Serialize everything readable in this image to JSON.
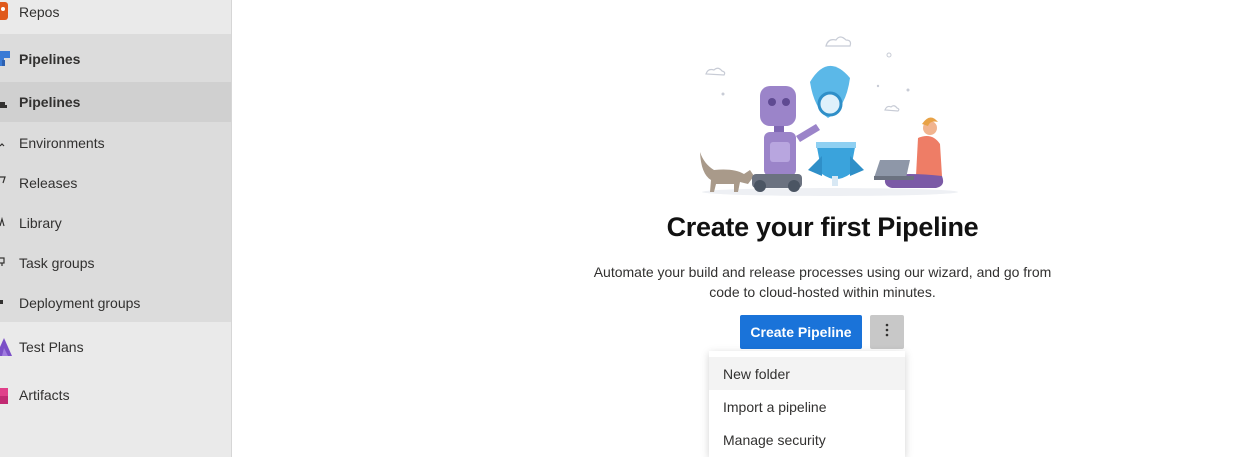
{
  "sidebar": {
    "items": [
      {
        "label": "Repos",
        "icon": "repos-icon",
        "color": "#e05a1c"
      },
      {
        "label": "Pipelines",
        "icon": "pipelines-icon",
        "color": "#3a7bd5"
      },
      {
        "label": "Pipelines",
        "icon": "pipelines-sub-icon"
      },
      {
        "label": "Environments",
        "icon": "environments-icon"
      },
      {
        "label": "Releases",
        "icon": "releases-icon"
      },
      {
        "label": "Library",
        "icon": "library-icon"
      },
      {
        "label": "Task groups",
        "icon": "task-groups-icon"
      },
      {
        "label": "Deployment groups",
        "icon": "deployment-groups-icon"
      },
      {
        "label": "Test Plans",
        "icon": "test-plans-icon",
        "color": "#7b4fc7"
      },
      {
        "label": "Artifacts",
        "icon": "artifacts-icon",
        "color": "#e0408a"
      }
    ]
  },
  "main": {
    "title": "Create your first Pipeline",
    "description": "Automate your build and release processes using our wizard, and go from code to cloud-hosted within minutes.",
    "create_button": "Create Pipeline",
    "more_icon": "more-vertical-icon"
  },
  "menu": {
    "items": [
      {
        "label": "New folder"
      },
      {
        "label": "Import a pipeline"
      },
      {
        "label": "Manage security"
      }
    ]
  },
  "colors": {
    "accent": "#1a73d9",
    "sidebar_bg": "#eaeaea",
    "selected_bg": "#d0d0d0"
  }
}
